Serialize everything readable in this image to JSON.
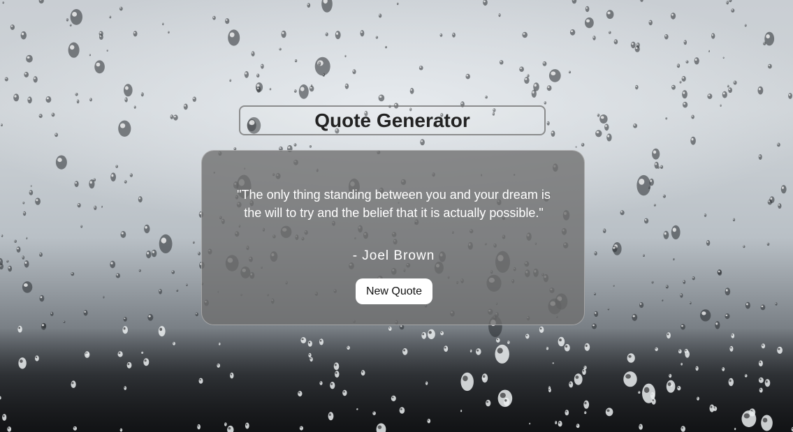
{
  "page": {
    "title": "Quote Generator"
  },
  "quote": {
    "text": "\"The only thing standing between you and your dream is the will to try and the belief that it is actually possible.\"",
    "author": "- Joel Brown"
  },
  "actions": {
    "new_quote_label": "New Quote"
  },
  "background": {
    "description_colors": {
      "sky": "#cfd4d8",
      "ground": "#1e2023"
    }
  },
  "colors": {
    "card": "#6e6e6e",
    "button": "#ffffff",
    "title_text": "#222222",
    "quote_text": "#ffffff"
  }
}
